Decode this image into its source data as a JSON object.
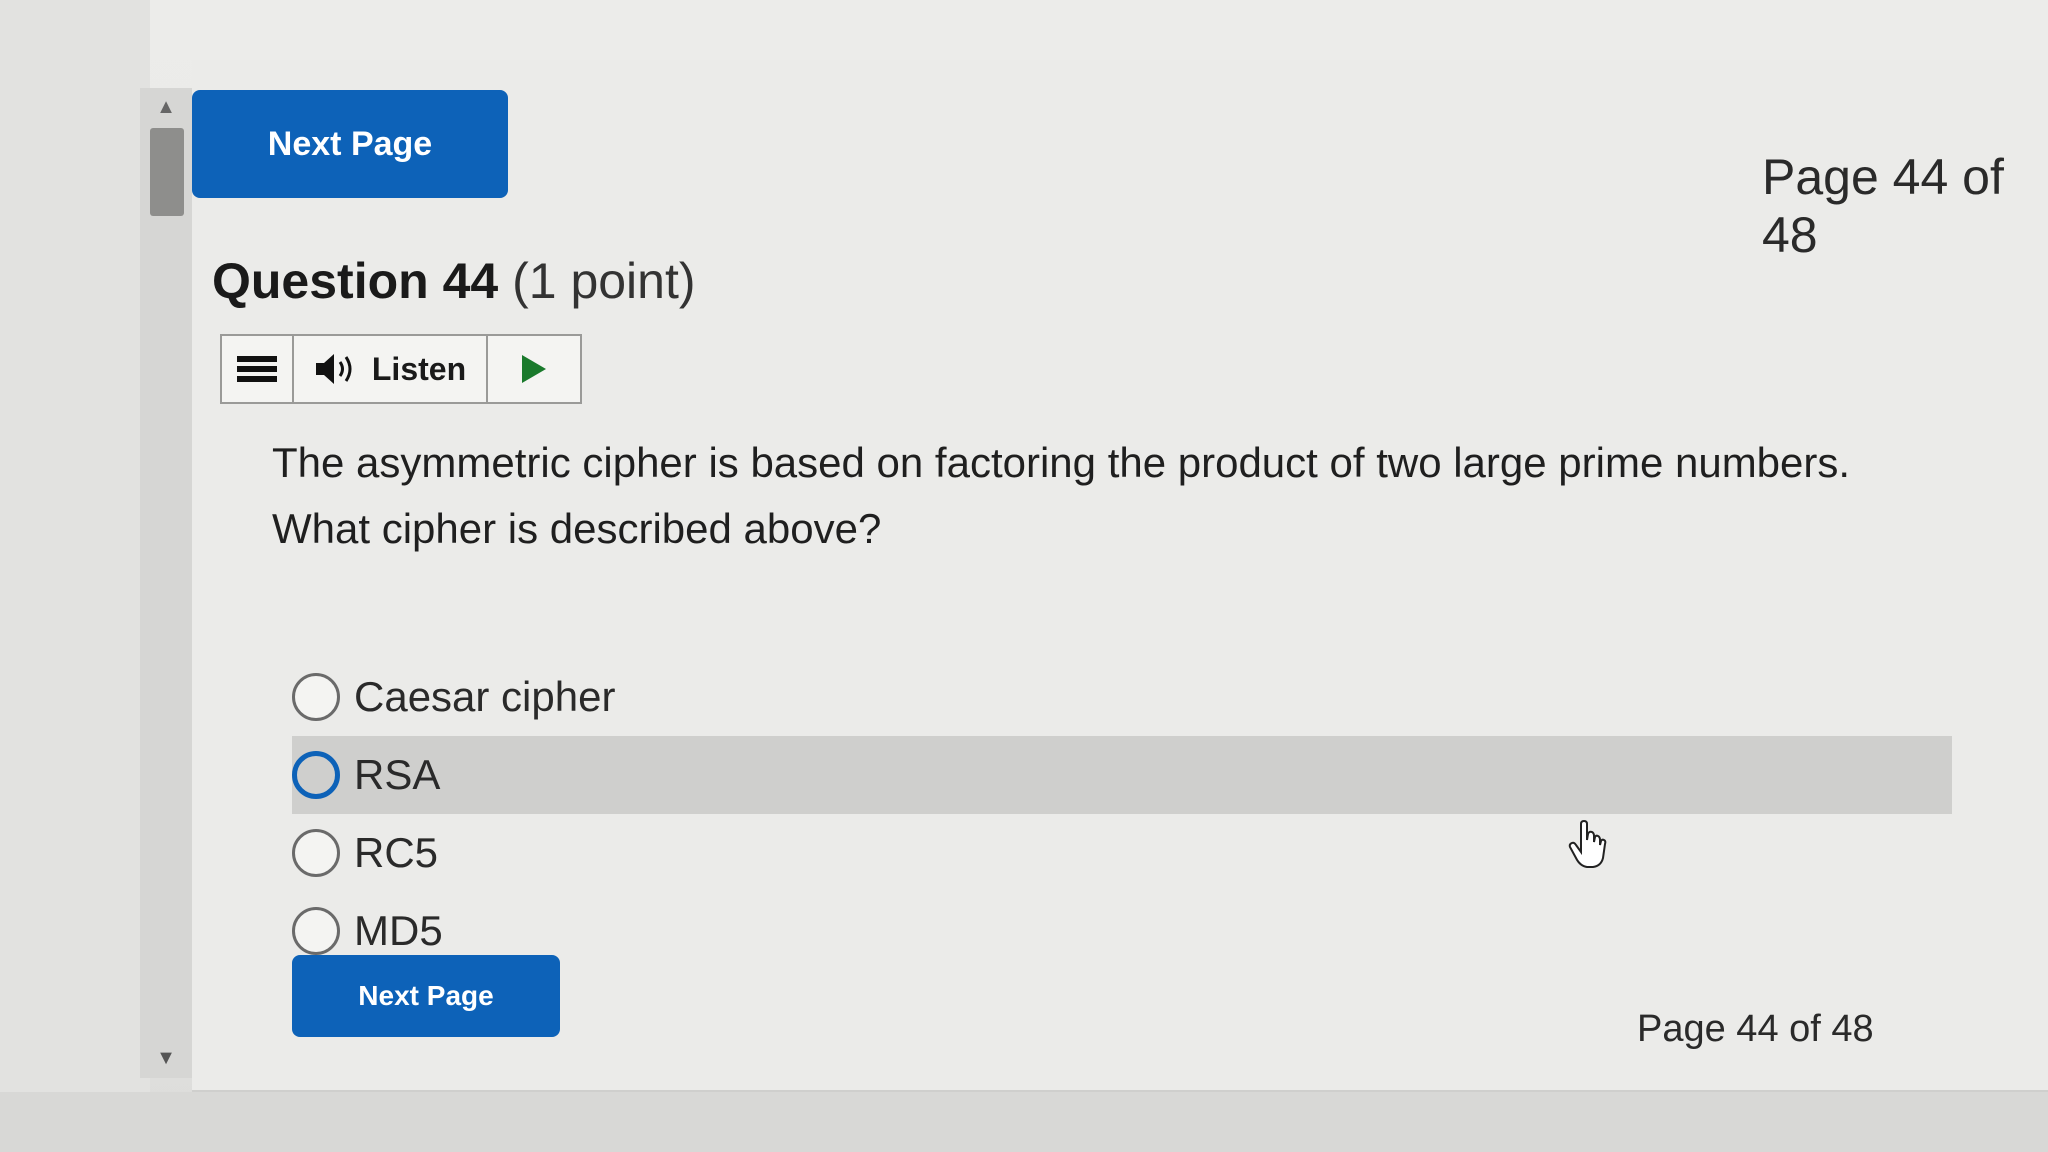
{
  "navigation": {
    "next_page_top": "Next Page",
    "next_page_bottom": "Next Page",
    "page_indicator_top": "Page 44 of 48",
    "page_indicator_bottom": "Page 44 of 48"
  },
  "question": {
    "number_label": "Question 44",
    "points_label": "(1 point)",
    "text": "The asymmetric cipher is based on factoring the product of two large prime numbers. What cipher is described above?",
    "options": [
      {
        "label": "Caesar cipher",
        "highlighted": false
      },
      {
        "label": "RSA",
        "highlighted": true
      },
      {
        "label": "RC5",
        "highlighted": false
      },
      {
        "label": "MD5",
        "highlighted": false
      }
    ]
  },
  "listen_toolbar": {
    "listen_label": "Listen",
    "menu_icon": "hamburger-menu-icon",
    "speaker_icon": "speaker-icon",
    "play_icon": "play-icon"
  },
  "colors": {
    "primary_button": "#0d62b8",
    "highlight_row": "#cfcfcd",
    "selected_radio_ring": "#0d62b8"
  }
}
